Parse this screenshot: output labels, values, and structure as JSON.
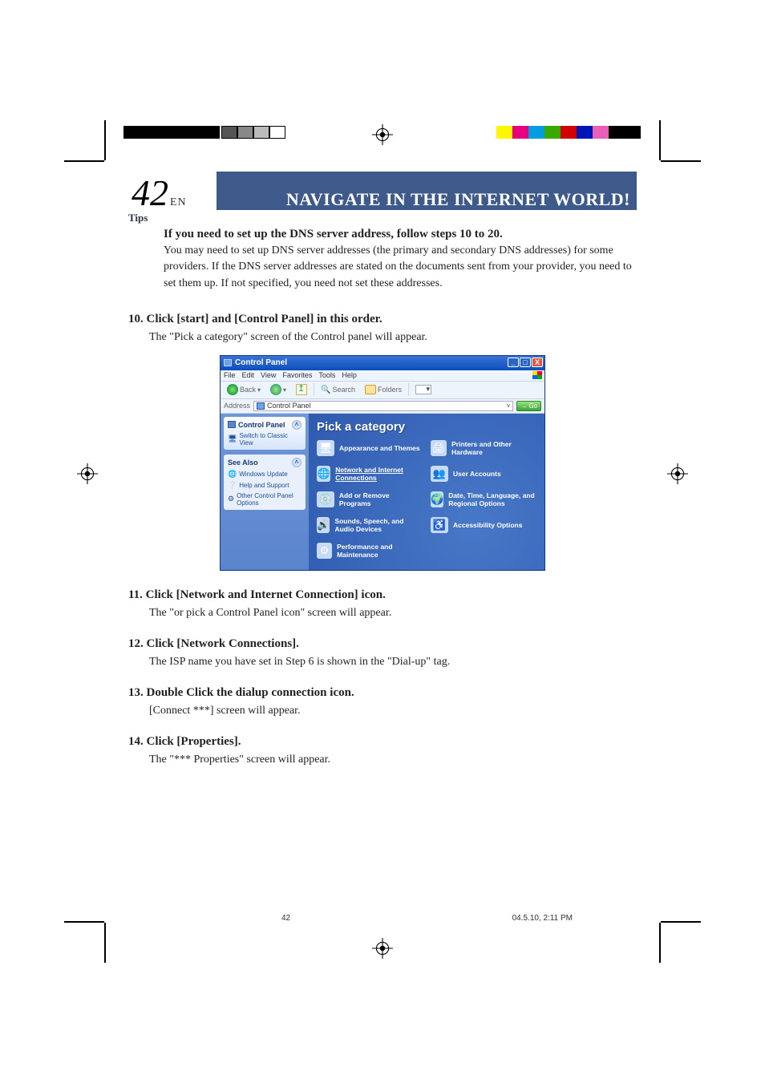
{
  "page": {
    "number": "42",
    "lang_tag": "EN",
    "header_title": "NAVIGATE IN THE INTERNET WORLD!",
    "tips_label": "Tips",
    "intro_bold": "If you need to set up the DNS server address, follow steps 10 to 20.",
    "intro_body": "You may need to set up DNS server addresses (the primary and secondary DNS addresses) for some providers.  If the DNS server addresses are stated on the documents sent from your provider, you need to set them up.  If not specified, you need not set these addresses."
  },
  "steps": [
    {
      "heading": "10. Click [start] and [Control Panel] in this order.",
      "body": "The \"Pick a category\" screen of the Control panel will appear."
    },
    {
      "heading": "11. Click [Network and Internet Connection] icon.",
      "body": "The \"or pick a Control Panel icon\" screen will appear."
    },
    {
      "heading": "12. Click [Network Connections].",
      "body": "The ISP name you have set in Step 6 is shown in the \"Dial-up\" tag."
    },
    {
      "heading": "13. Double Click the dialup connection icon.",
      "body": " [Connect ***] screen will appear."
    },
    {
      "heading": "14. Click [Properties].",
      "body": "The \"*** Properties\" screen will appear."
    }
  ],
  "control_panel": {
    "title": "Control Panel",
    "menu": [
      "File",
      "Edit",
      "View",
      "Favorites",
      "Tools",
      "Help"
    ],
    "toolbar": {
      "back": "Back",
      "search": "Search",
      "folders": "Folders"
    },
    "address_label": "Address",
    "address_value": "Control Panel",
    "go_label": "Go",
    "pick_heading": "Pick a category",
    "side": {
      "panel_title": "Control Panel",
      "switch_view": "Switch to Classic View",
      "see_also": "See Also",
      "links": [
        "Windows Update",
        "Help and Support",
        "Other Control Panel Options"
      ]
    },
    "categories_left": [
      {
        "label": "Appearance and Themes",
        "glyph": "🖥",
        "bg": "#8fb4e8"
      },
      {
        "label": "Network and Internet Connections",
        "glyph": "🌐",
        "bg": "#8ab2e6",
        "underline": true
      },
      {
        "label": "Add or Remove Programs",
        "glyph": "💿",
        "bg": "#8ab2e6"
      },
      {
        "label": "Sounds, Speech, and Audio Devices",
        "glyph": "🔊",
        "bg": "#8ab2e6"
      },
      {
        "label": "Performance and Maintenance",
        "glyph": "⚙",
        "bg": "#8ab2e6"
      }
    ],
    "categories_right": [
      {
        "label": "Printers and Other Hardware",
        "glyph": "🖨",
        "bg": "#8ab2e6"
      },
      {
        "label": "User Accounts",
        "glyph": "👥",
        "bg": "#8ab2e6"
      },
      {
        "label": "Date, Time, Language, and Regional Options",
        "glyph": "🌍",
        "bg": "#8ab2e6"
      },
      {
        "label": "Accessibility Options",
        "glyph": "♿",
        "bg": "#8ab2e6"
      }
    ]
  },
  "footer": {
    "page_small": "42",
    "date": "04.5.10, 2:11 PM"
  },
  "colorbar": {
    "left_solid": "#000",
    "grays": [
      "#555",
      "#888",
      "#bbb",
      "#fff"
    ],
    "right": [
      "#fff600",
      "#e6007e",
      "#009ee0",
      "#38a800",
      "#d40000",
      "#0015b8",
      "#e95fb7",
      "#000"
    ]
  }
}
